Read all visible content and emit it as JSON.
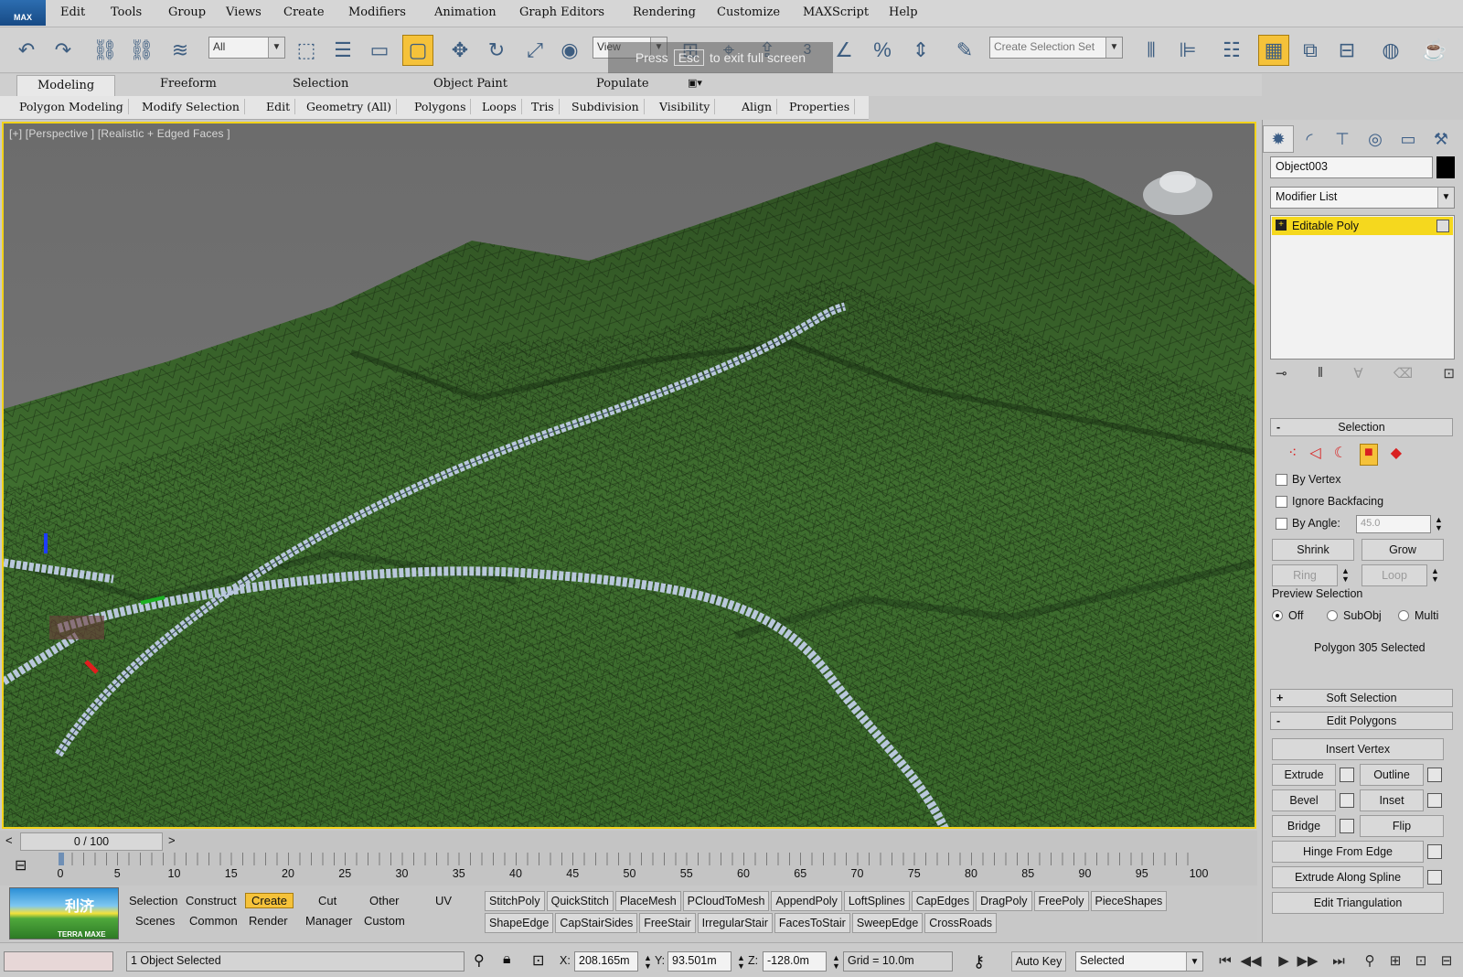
{
  "menubar": {
    "logo": "MAX",
    "items": [
      "Edit",
      "Tools",
      "Group",
      "Views",
      "Create",
      "Modifiers",
      "Animation",
      "Graph Editors",
      "Rendering",
      "Customize",
      "MAXScript",
      "Help"
    ]
  },
  "toolbar": {
    "selection_filter": "All",
    "ref_coord": "View",
    "snap_value": "3",
    "named_selection_placeholder": "Create Selection Set",
    "esc_hint_pre": "Press",
    "esc_key": "Esc",
    "esc_hint_post": "to exit full screen"
  },
  "ribbon": {
    "tabs": [
      "Modeling",
      "Freeform",
      "Selection",
      "Object Paint",
      "Populate"
    ],
    "active_tab": "Modeling",
    "panels": [
      "Polygon Modeling",
      "Modify Selection",
      "Edit",
      "Geometry (All)",
      "Polygons",
      "Loops",
      "Tris",
      "Subdivision",
      "Visibility",
      "Align",
      "Properties"
    ]
  },
  "viewport": {
    "label": "[+] [Perspective ] [Realistic + Edged Faces ]"
  },
  "command_panel": {
    "object_name": "Object003",
    "modifier_list": "Modifier List",
    "stack_item": "Editable Poly",
    "selection": {
      "header": "Selection",
      "by_vertex": "By Vertex",
      "ignore_backfacing": "Ignore Backfacing",
      "by_angle": "By Angle:",
      "angle_value": "45.0",
      "shrink": "Shrink",
      "grow": "Grow",
      "ring": "Ring",
      "loop": "Loop",
      "preview_selection": "Preview Selection",
      "preview_off": "Off",
      "preview_subobj": "SubObj",
      "preview_multi": "Multi",
      "status": "Polygon 305 Selected"
    },
    "soft_selection": "Soft Selection",
    "edit_polygons": {
      "header": "Edit Polygons",
      "insert_vertex": "Insert Vertex",
      "extrude": "Extrude",
      "outline": "Outline",
      "bevel": "Bevel",
      "inset": "Inset",
      "bridge": "Bridge",
      "flip": "Flip",
      "hinge_from_edge": "Hinge From Edge",
      "extrude_along_spline": "Extrude Along Spline",
      "edit_triangulation": "Edit Triangulation"
    }
  },
  "timeline": {
    "slider": "0 / 100",
    "prev": "<",
    "next": ">",
    "ticks": [
      "0",
      "5",
      "10",
      "15",
      "20",
      "25",
      "30",
      "35",
      "40",
      "45",
      "50",
      "55",
      "60",
      "65",
      "70",
      "75",
      "80",
      "85",
      "90",
      "95",
      "100"
    ]
  },
  "terramax": {
    "logo_text": "利济",
    "logo_sub": "TERRA MAXE",
    "tabs_row1": [
      "Selection",
      "Construct",
      "Create",
      "Cut",
      "Other",
      "UV"
    ],
    "tabs_row2": [
      "Scenes",
      "Common",
      "Render",
      "Manager",
      "Custom"
    ],
    "active_tab": "Create",
    "buttons_row1": [
      "StitchPoly",
      "QuickStitch",
      "PlaceMesh",
      "PCloudToMesh",
      "AppendPoly",
      "LoftSplines",
      "CapEdges",
      "DragPoly",
      "FreePoly",
      "PieceShapes"
    ],
    "buttons_row2": [
      "ShapeEdge",
      "CapStairSides",
      "FreeStair",
      "IrregularStair",
      "FacesToStair",
      "SweepEdge",
      "CrossRoads"
    ]
  },
  "status": {
    "selected": "1 Object Selected",
    "x_label": "X:",
    "x_value": "208.165m",
    "y_label": "Y:",
    "y_value": "93.501m",
    "z_label": "Z:",
    "z_value": "-128.0m",
    "grid": "Grid = 10.0m",
    "auto_key": "Auto Key",
    "key_filter": "Selected"
  },
  "colors": {
    "active_yellow": "#f5c23a",
    "viewport_border": "#f2d21a",
    "terrain_green": "#3e6e2e",
    "road_blue": "#b9c8dc"
  }
}
